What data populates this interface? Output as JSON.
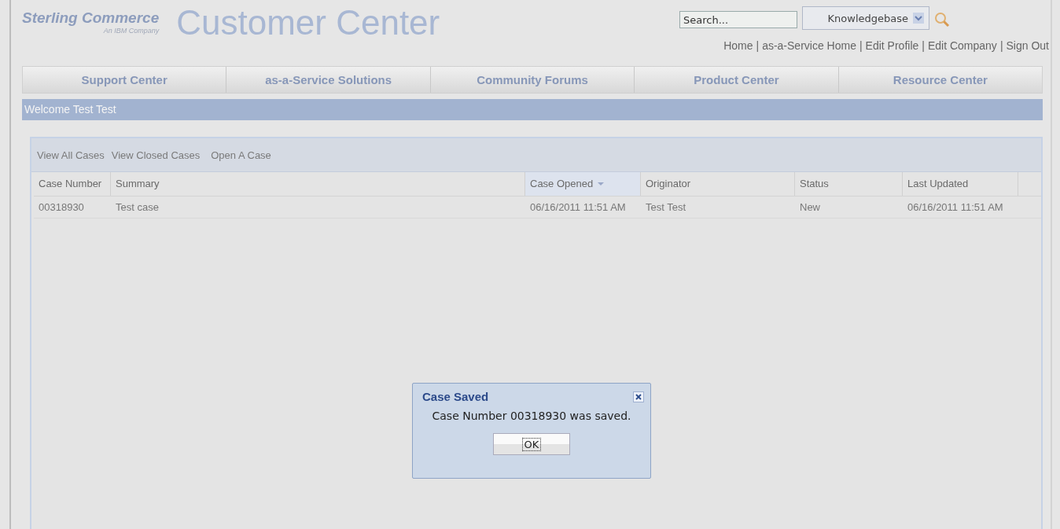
{
  "logo": {
    "brand": "Sterling Commerce",
    "tagline": "An IBM Company"
  },
  "site_title": "Customer Center",
  "search": {
    "placeholder": "Search...",
    "scope": "Knowledgebase"
  },
  "top_links": {
    "separator": "|",
    "items": [
      "Home",
      "as-a-Service Home",
      "Edit Profile",
      "Edit Company",
      "Sign Out"
    ]
  },
  "nav_tabs": [
    {
      "label": "Support Center",
      "selected": false
    },
    {
      "label": "as-a-Service Solutions",
      "selected": false
    },
    {
      "label": "Community Forums",
      "selected": false
    },
    {
      "label": "Product Center",
      "selected": false
    },
    {
      "label": "Resource Center",
      "selected": false
    }
  ],
  "welcome": "Welcome Test Test",
  "case_links": [
    "View All Cases",
    "View Closed Cases",
    "Open A Case"
  ],
  "table": {
    "columns": [
      {
        "label": "Case Number",
        "sorted": false
      },
      {
        "label": "Summary",
        "sorted": false
      },
      {
        "label": "Case Opened",
        "sorted": true
      },
      {
        "label": "Originator",
        "sorted": false
      },
      {
        "label": "Status",
        "sorted": false
      },
      {
        "label": "Last Updated",
        "sorted": false
      }
    ],
    "rows": [
      [
        "00318930",
        "Test case",
        "06/16/2011 11:51 AM",
        "Test Test",
        "New",
        "06/16/2011 11:51 AM"
      ]
    ]
  },
  "dialog": {
    "title": "Case Saved",
    "message": "Case Number 00318930 was saved.",
    "button": "OK"
  }
}
